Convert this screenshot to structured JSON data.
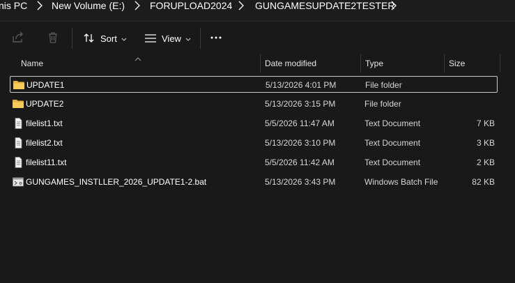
{
  "breadcrumb": {
    "items": [
      "nis PC",
      "New Volume (E:)",
      "FORUPLOAD2024",
      "GUNGAMESUPDATE2TESTER"
    ]
  },
  "toolbar": {
    "sort_label": "Sort",
    "view_label": "View",
    "share_icon": "share-icon",
    "delete_icon": "trash-icon",
    "more_icon": "more-icon"
  },
  "columns": {
    "name": "Name",
    "date": "Date modified",
    "type": "Type",
    "size": "Size"
  },
  "files": [
    {
      "name": "UPDATE1",
      "date": "5/13/2026 4:01 PM",
      "type": "File folder",
      "size": "",
      "icon": "folder-icon",
      "selected": true
    },
    {
      "name": "UPDATE2",
      "date": "5/13/2026 3:15 PM",
      "type": "File folder",
      "size": "",
      "icon": "folder-icon",
      "selected": false
    },
    {
      "name": "filelist1.txt",
      "date": "5/5/2026 11:47 AM",
      "type": "Text Document",
      "size": "7 KB",
      "icon": "text-file-icon",
      "selected": false
    },
    {
      "name": "filelist2.txt",
      "date": "5/13/2026 3:10 PM",
      "type": "Text Document",
      "size": "3 KB",
      "icon": "text-file-icon",
      "selected": false
    },
    {
      "name": "filelist11.txt",
      "date": "5/5/2026 11:42 AM",
      "type": "Text Document",
      "size": "2 KB",
      "icon": "text-file-icon",
      "selected": false
    },
    {
      "name": "GUNGAMES_INSTLLER_2026_UPDATE1-2.bat",
      "date": "5/13/2026 3:43 PM",
      "type": "Windows Batch File",
      "size": "82 KB",
      "icon": "batch-file-icon",
      "selected": false
    }
  ],
  "colors": {
    "background": "#191919",
    "folder": "#f0c24a",
    "text": "#ffffff"
  }
}
